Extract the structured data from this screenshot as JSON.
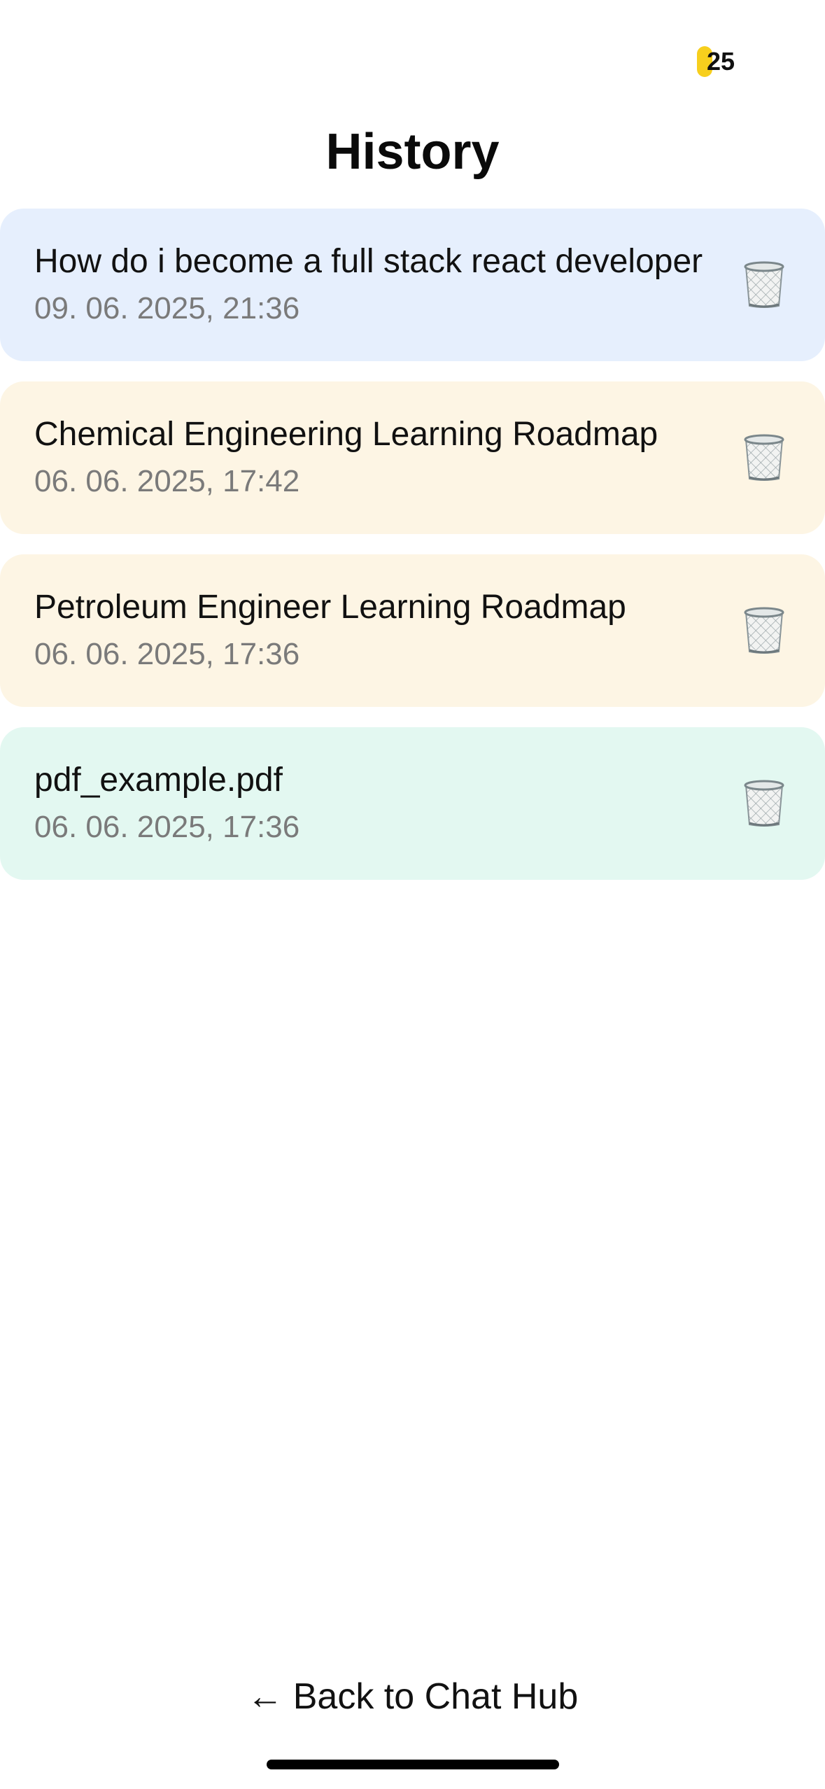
{
  "header": {
    "credits": "25",
    "credits_color": "#f7cf1d",
    "title": "History"
  },
  "history": [
    {
      "title": "How do i become a full stack react developer",
      "date": "09. 06. 2025, 21:36",
      "bg": "#e6effd",
      "icon": "trash-can-icon"
    },
    {
      "title": "Chemical Engineering Learning Roadmap",
      "date": "06. 06. 2025, 17:42",
      "bg": "#fdf5e4",
      "icon": "trash-can-icon"
    },
    {
      "title": "Petroleum Engineer Learning Roadmap",
      "date": "06. 06. 2025, 17:36",
      "bg": "#fdf5e4",
      "icon": "trash-can-icon"
    },
    {
      "title": "pdf_example.pdf",
      "date": "06. 06. 2025, 17:36",
      "bg": "#e3f8f1",
      "icon": "trash-can-icon"
    }
  ],
  "footer": {
    "arrow": "←",
    "back_label": "Back to Chat Hub"
  }
}
